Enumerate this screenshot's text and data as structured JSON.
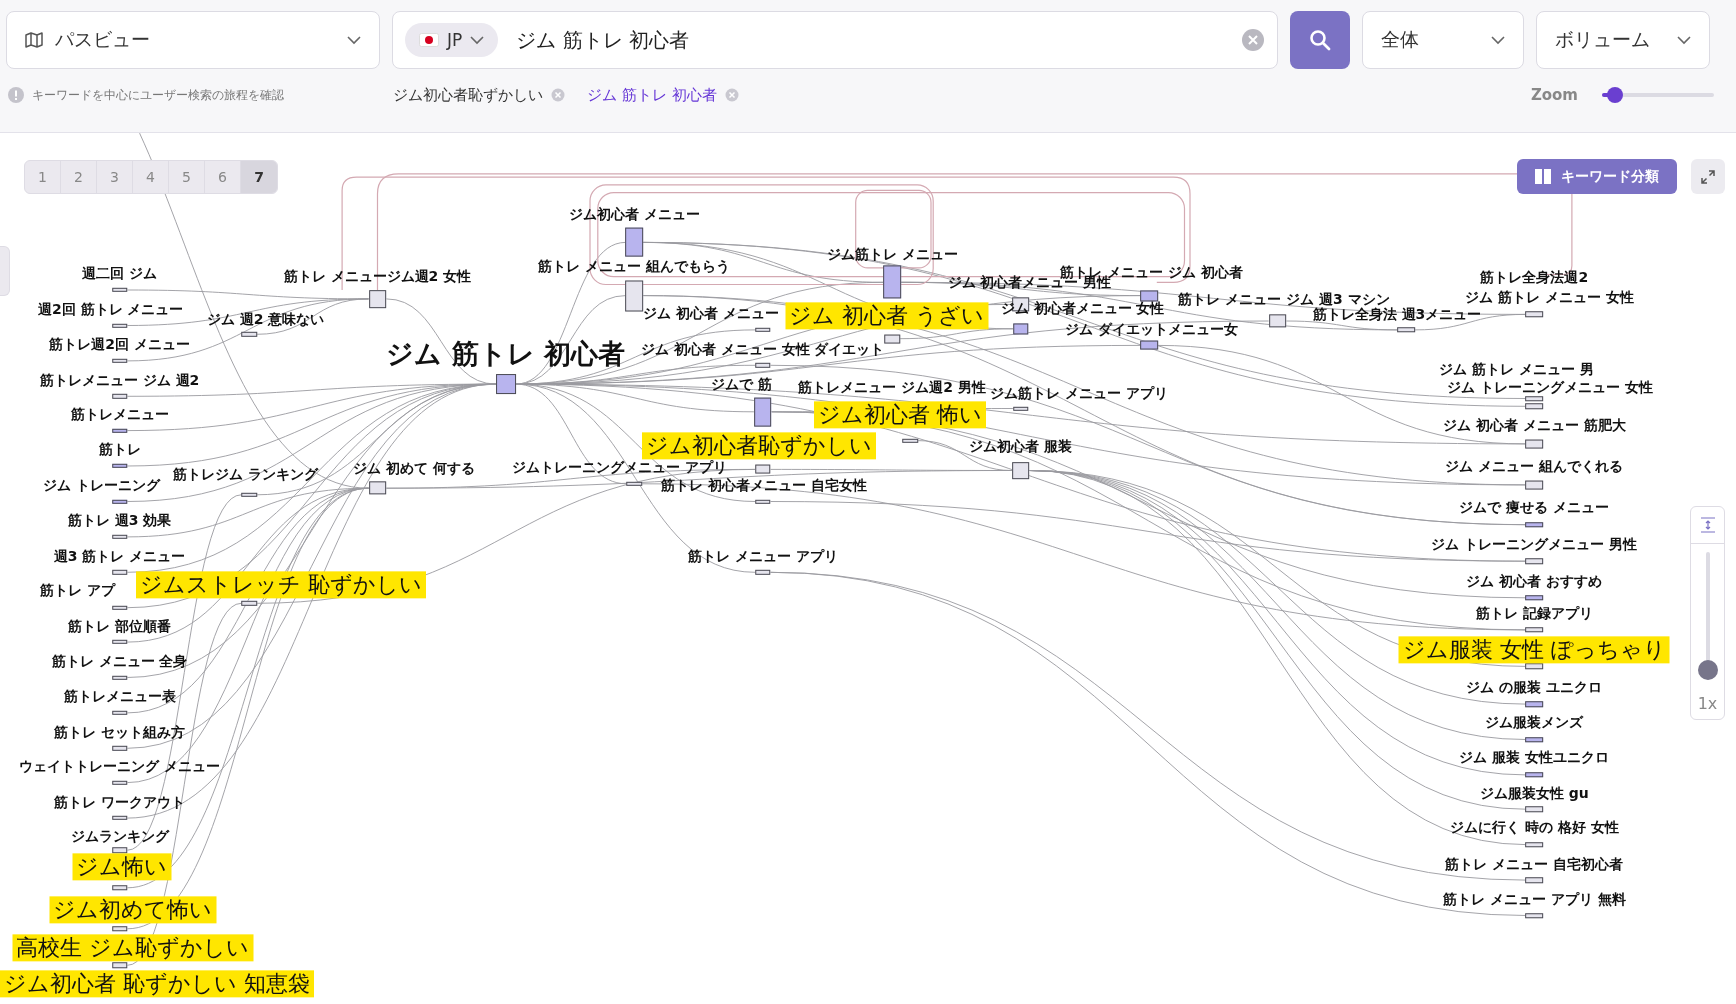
{
  "header": {
    "view_select": {
      "value": "パスビュー"
    },
    "search": {
      "country": "JP",
      "value": "ジム 筋トレ 初心者"
    },
    "scope_select": {
      "value": "全体"
    },
    "sort_select": {
      "value": "ボリューム"
    }
  },
  "hint": "キーワードを中心にユーザー検索の旅程を確認",
  "chips": [
    {
      "label": "ジム初心者恥ずかしい",
      "selected": false
    },
    {
      "label": "ジム 筋トレ 初心者",
      "selected": true
    }
  ],
  "zoom": {
    "label": "Zoom",
    "level": 0.05
  },
  "steps": [
    {
      "label": "1",
      "selected": false
    },
    {
      "label": "2",
      "selected": false
    },
    {
      "label": "3",
      "selected": false
    },
    {
      "label": "4",
      "selected": false
    },
    {
      "label": "5",
      "selected": false
    },
    {
      "label": "6",
      "selected": false
    },
    {
      "label": "7",
      "selected": true
    }
  ],
  "classify_button": "キーワード分類",
  "graph": {
    "nodes": [
      {
        "label": "ジム初心者 メニュー",
        "kind": "keyword",
        "color": "#b8b4ee"
      },
      {
        "label": "ジム筋トレ メニュー",
        "kind": "keyword",
        "color": "#b8b4ee"
      },
      {
        "label": "筋トレ メニュー 組んでもらう",
        "kind": "keyword",
        "color": "#e6e5ee"
      },
      {
        "label": "週二回 ジム",
        "kind": "keyword",
        "color": "#e6e5ee"
      },
      {
        "label": "筋トレ メニュージム週2 女性",
        "kind": "keyword",
        "color": "#e6e5ee"
      },
      {
        "label": "筋トレ メニュー ジム 初心者",
        "kind": "keyword",
        "color": "#b8b4ee"
      },
      {
        "label": "ジム 初心者メニュー 男性",
        "kind": "keyword",
        "color": "#e6e5ee"
      },
      {
        "label": "筋トレ全身法週2",
        "kind": "keyword"
      },
      {
        "label": "筋トレ メニュー ジム 週3 マシン",
        "kind": "keyword",
        "color": "#e6e5ee"
      },
      {
        "label": "ジム 筋トレ メニュー 女性",
        "kind": "keyword",
        "color": "#e6e5ee"
      },
      {
        "label": "週2回 筋トレ メニュー",
        "kind": "keyword",
        "color": "#e6e5ee"
      },
      {
        "label": "ジム 初心者メニュー 女性",
        "kind": "keyword",
        "color": "#b8b4ee"
      },
      {
        "label": "ジム 週2 意味ない",
        "kind": "keyword",
        "color": "#e6e5ee"
      },
      {
        "label": "ジム 初心者 メニュー",
        "kind": "keyword",
        "color": "#e6e5ee"
      },
      {
        "label": "ジム 初心者 うざい",
        "kind": "highlighted",
        "color": "#e6e5ee"
      },
      {
        "label": "筋トレ全身法 週3メニュー",
        "kind": "keyword",
        "color": "#e6e5ee"
      },
      {
        "label": "ジム ダイエットメニュー女",
        "kind": "keyword",
        "color": "#b8b4ee"
      },
      {
        "label": "筋トレ週2回 メニュー",
        "kind": "keyword",
        "color": "#e6e5ee"
      },
      {
        "label": "ジム 筋トレ 初心者",
        "kind": "center",
        "color": "#b8b4ee"
      },
      {
        "label": "ジム 初心者 メニュー 女性 ダイエット",
        "kind": "keyword",
        "color": "#e6e5ee"
      },
      {
        "label": "ジム 筋トレ メニュー 男",
        "kind": "keyword",
        "color": "#e6e5ee"
      },
      {
        "label": "筋トレメニュー ジム 週2",
        "kind": "keyword",
        "color": "#e6e5ee"
      },
      {
        "label": "ジムで 筋",
        "kind": "keyword",
        "color": "#b8b4ee"
      },
      {
        "label": "筋トレメニュー ジム週2 男性",
        "kind": "keyword"
      },
      {
        "label": "ジム トレーニングメニュー 女性",
        "kind": "keyword",
        "color": "#e6e5ee"
      },
      {
        "label": "ジム筋トレ メニュー アプリ",
        "kind": "keyword",
        "color": "#e6e5ee"
      },
      {
        "label": "筋トレメニュー",
        "kind": "keyword",
        "color": "#b8b4ee"
      },
      {
        "label": "ジム初心者 怖い",
        "kind": "highlighted",
        "color": "#e6e5ee"
      },
      {
        "label": "ジム 初心者 メニュー 筋肥大",
        "kind": "keyword",
        "color": "#e6e5ee"
      },
      {
        "label": "筋トレ",
        "kind": "keyword",
        "color": "#b8b4ee"
      },
      {
        "label": "ジム初心者恥ずかしい",
        "kind": "highlighted",
        "color": "#e6e5ee"
      },
      {
        "label": "ジム初心者 服装",
        "kind": "keyword",
        "color": "#e6e5ee"
      },
      {
        "label": "筋トレジム ランキング",
        "kind": "keyword",
        "color": "#e6e5ee"
      },
      {
        "label": "ジム 初めて 何する",
        "kind": "keyword",
        "color": "#e6e5ee"
      },
      {
        "label": "ジムトレーニングメニュー アプリ",
        "kind": "keyword",
        "color": "#e6e5ee"
      },
      {
        "label": "ジム メニュー 組んでくれる",
        "kind": "keyword",
        "color": "#e6e5ee"
      },
      {
        "label": "ジム トレーニング",
        "kind": "keyword",
        "color": "#b8b4ee"
      },
      {
        "label": "筋トレ 初心者メニュー 自宅女性",
        "kind": "keyword",
        "color": "#e6e5ee"
      },
      {
        "label": "ジムで 痩せる メニュー",
        "kind": "keyword",
        "color": "#b8b4ee"
      },
      {
        "label": "筋トレ 週3 効果",
        "kind": "keyword",
        "color": "#e6e5ee"
      },
      {
        "label": "ジム トレーニングメニュー 男性",
        "kind": "keyword",
        "color": "#e6e5ee"
      },
      {
        "label": "週3 筋トレ メニュー",
        "kind": "keyword",
        "color": "#e6e5ee"
      },
      {
        "label": "筋トレ メニュー アプリ",
        "kind": "keyword",
        "color": "#e6e5ee"
      },
      {
        "label": "ジムストレッチ 恥ずかしい",
        "kind": "highlighted",
        "color": "#e6e5ee"
      },
      {
        "label": "ジム 初心者 おすすめ",
        "kind": "keyword",
        "color": "#b8b4ee"
      },
      {
        "label": "筋トレ アプ",
        "kind": "keyword",
        "color": "#e6e5ee"
      },
      {
        "label": "筋トレ 記録アプリ",
        "kind": "keyword",
        "color": "#e6e5ee"
      },
      {
        "label": "筋トレ 部位順番",
        "kind": "keyword",
        "color": "#e6e5ee"
      },
      {
        "label": "ジム服装 女性 ぽっちゃり",
        "kind": "highlighted",
        "color": "#e6e5ee"
      },
      {
        "label": "筋トレ メニュー 全身",
        "kind": "keyword",
        "color": "#e6e5ee"
      },
      {
        "label": "ジム の服装 ユニクロ",
        "kind": "keyword",
        "color": "#b8b4ee"
      },
      {
        "label": "筋トレメニュー表",
        "kind": "keyword",
        "color": "#e6e5ee"
      },
      {
        "label": "ジム服装メンズ",
        "kind": "keyword",
        "color": "#b8b4ee"
      },
      {
        "label": "筋トレ セット組み方",
        "kind": "keyword",
        "color": "#e6e5ee"
      },
      {
        "label": "ジム 服装 女性ユニクロ",
        "kind": "keyword",
        "color": "#b8b4ee"
      },
      {
        "label": "ウェイトトレーニング メニュー",
        "kind": "keyword",
        "color": "#e6e5ee"
      },
      {
        "label": "ジム服装女性 gu",
        "kind": "keyword",
        "color": "#e6e5ee"
      },
      {
        "label": "筋トレ ワークアウト",
        "kind": "keyword",
        "color": "#e6e5ee"
      },
      {
        "label": "ジムに行く 時の 格好 女性",
        "kind": "keyword",
        "color": "#e6e5ee"
      },
      {
        "label": "ジムランキング",
        "kind": "keyword",
        "color": "#e6e5ee"
      },
      {
        "label": "ジム怖い",
        "kind": "highlighted",
        "color": "#e6e5ee"
      },
      {
        "label": "筋トレ メニュー 自宅初心者",
        "kind": "keyword",
        "color": "#e6e5ee"
      },
      {
        "label": "筋トレ メニュー アプリ 無料",
        "kind": "keyword",
        "color": "#e6e5ee"
      },
      {
        "label": "ジム初めて怖い",
        "kind": "highlighted",
        "color": "#e6e5ee"
      },
      {
        "label": "高校生 ジム恥ずかしい",
        "kind": "highlighted",
        "color": "#e6e5ee"
      },
      {
        "label": "ジム初心者 恥ずかしい 知恵袋",
        "kind": "highlighted"
      }
    ]
  },
  "vertical_zoom": {
    "label": "1x",
    "level": 0
  }
}
